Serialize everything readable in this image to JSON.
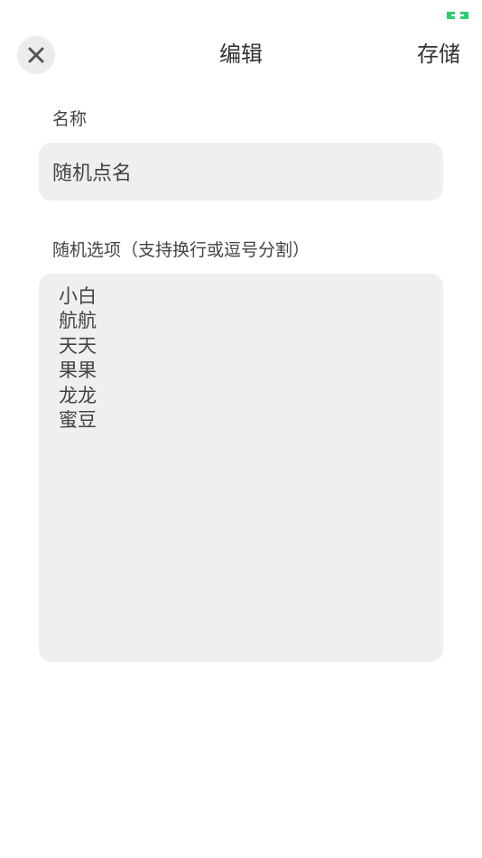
{
  "status_bar": {
    "icon": "link-icon",
    "color": "#2ecc71"
  },
  "header": {
    "close_icon": "close-icon",
    "title": "编辑",
    "save_label": "存储"
  },
  "form": {
    "name_label": "名称",
    "name_value": "随机点名",
    "options_label": "随机选项（支持换行或逗号分割）",
    "options_value": "小白\n航航\n天天\n果果\n龙龙\n蜜豆"
  }
}
